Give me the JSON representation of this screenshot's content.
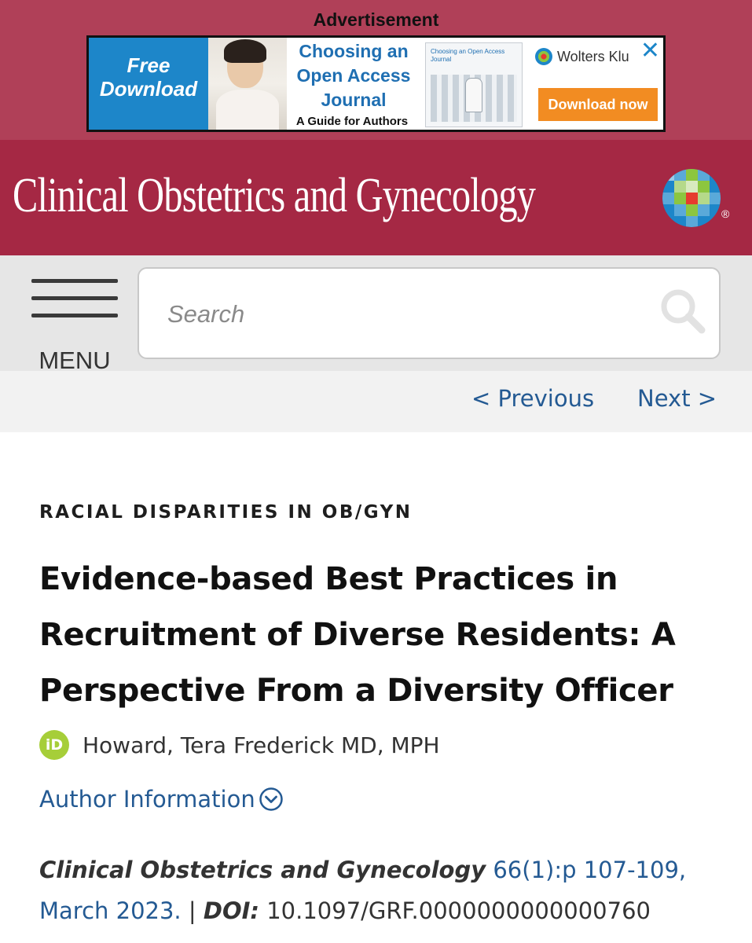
{
  "ad": {
    "label": "Advertisement",
    "free_download": "Free Download",
    "headline": "Choosing an Open Access Journal",
    "subline": "A Guide for Authors",
    "thumb_text": "Choosing an Open Access Journal",
    "brand": "Wolters Klu",
    "cta": "Download now",
    "close_icon": "close-icon"
  },
  "journal": {
    "title": "Clinical Obstetrics and Gynecology",
    "logo": "wolters-kluwer-logo",
    "registered_mark": "®"
  },
  "search": {
    "menu_label": "MENU",
    "placeholder": "Search"
  },
  "pager": {
    "previous": "< Previous",
    "next": "Next >"
  },
  "article": {
    "category": "RACIAL DISPARITIES IN OB/GYN",
    "title": "Evidence-based Best Practices in Recruitment of Diverse Residents: A Perspective From a Diversity Officer",
    "orcid_label": "iD",
    "author": "Howard, Tera Frederick MD, MPH",
    "author_info": "Author Information",
    "citation": {
      "journal": "Clinical Obstetrics and Gynecology",
      "volume_pages": "66(1):p 107-109,",
      "date": "March 2023.",
      "separator": "|",
      "doi_label": "DOI:",
      "doi": "10.1097/GRF.0000000000000760"
    }
  },
  "colors": {
    "ad_band": "#b04058",
    "header": "#a52844",
    "link": "#245a93",
    "orcid": "#a6ce39",
    "cta": "#f28c22"
  }
}
